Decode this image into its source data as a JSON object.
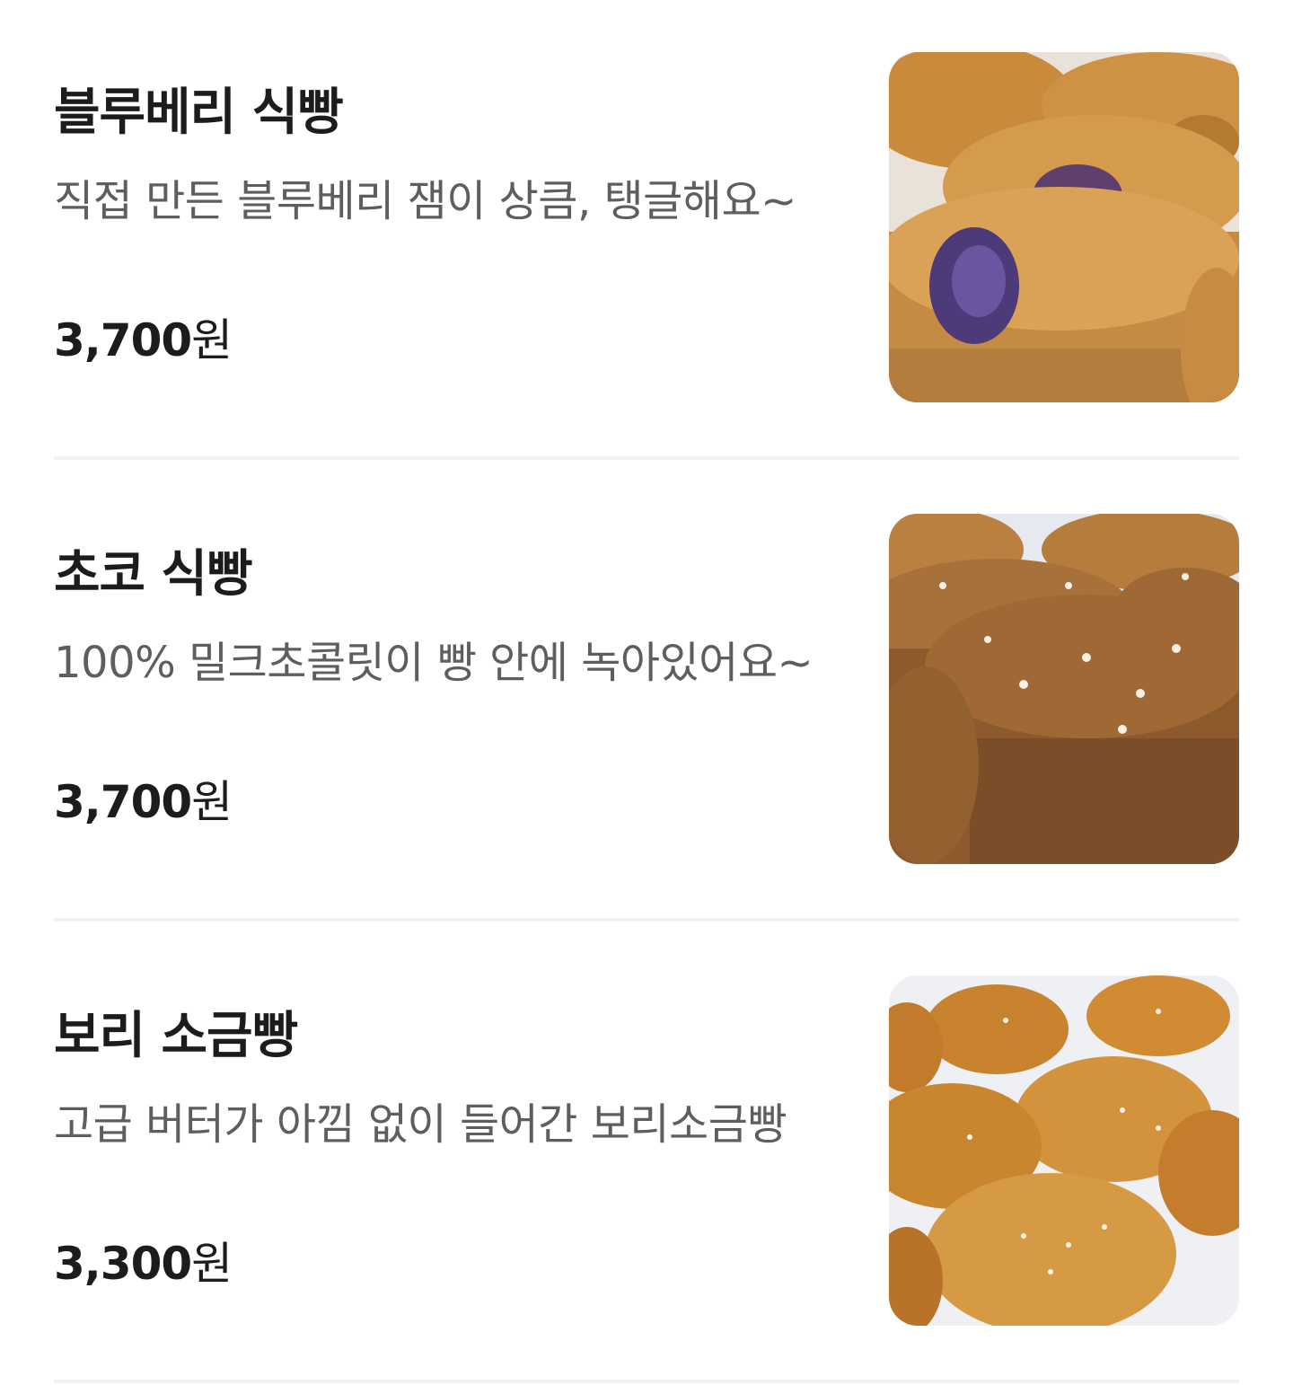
{
  "menu": {
    "items": [
      {
        "name": "블루베리 식빵",
        "description": "직접 만든 블루베리 잼이 상큼, 탱글해요~",
        "price": "3,700",
        "currency": "원",
        "image": "blueberry-bread-photo"
      },
      {
        "name": "초코 식빵",
        "description": "100% 밀크초콜릿이 빵 안에 녹아있어요~",
        "price": "3,700",
        "currency": "원",
        "image": "chocolate-bread-photo"
      },
      {
        "name": "보리 소금빵",
        "description": "고급 버터가 아낌 없이 들어간 보리소금빵",
        "price": "3,300",
        "currency": "원",
        "image": "barley-salt-bread-photo"
      }
    ]
  }
}
